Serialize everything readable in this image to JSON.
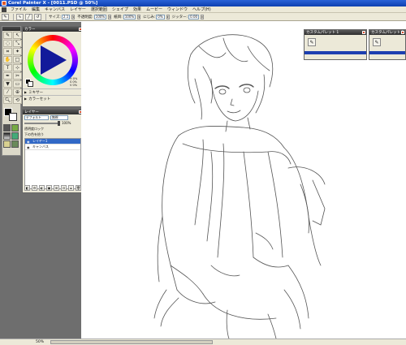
{
  "window": {
    "title": "Corel Painter X - [0011.PSD @ 50%]"
  },
  "menu": {
    "items": [
      "ファイル",
      "編集",
      "キャンバス",
      "レイヤー",
      "選択範囲",
      "シェイプ",
      "効果",
      "ムービー",
      "ウィンドウ",
      "ヘルプ(H)"
    ]
  },
  "propbar": {
    "size_label": "サイズ:",
    "size_value": "2.1",
    "opacity_label": "不透明度:",
    "opacity_value": "100%",
    "grain_label": "紙目:",
    "grain_value": "100%",
    "blend_label": "にじみ:",
    "blend_value": "0%",
    "jitter_label": "ジッター:",
    "jitter_value": "0.00"
  },
  "color_panel": {
    "title": "カラー",
    "hsv": [
      "H 0%",
      "S 0%",
      "V 0%"
    ],
    "mixer_label": "ミキサー",
    "color_set_label": "カラーセット"
  },
  "layers_panel": {
    "title": "レイヤー",
    "composite_method": "デフォルト",
    "preserve_label": "無視",
    "opacity_value": "100%",
    "options": [
      "透明度ロック",
      "下の色を拾う"
    ],
    "layers": [
      {
        "name": "レイヤー1",
        "selected": true
      },
      {
        "name": "キャンバス",
        "selected": false
      }
    ]
  },
  "palettes": [
    {
      "title": "カスタムパレット 1"
    },
    {
      "title": "カスタムパレット 2"
    }
  ],
  "status": {
    "zoom": "50%"
  },
  "colors": {
    "accent": "#2a63d8",
    "selected_layer": "#3168c6",
    "workspace": "#6e6e6e"
  }
}
